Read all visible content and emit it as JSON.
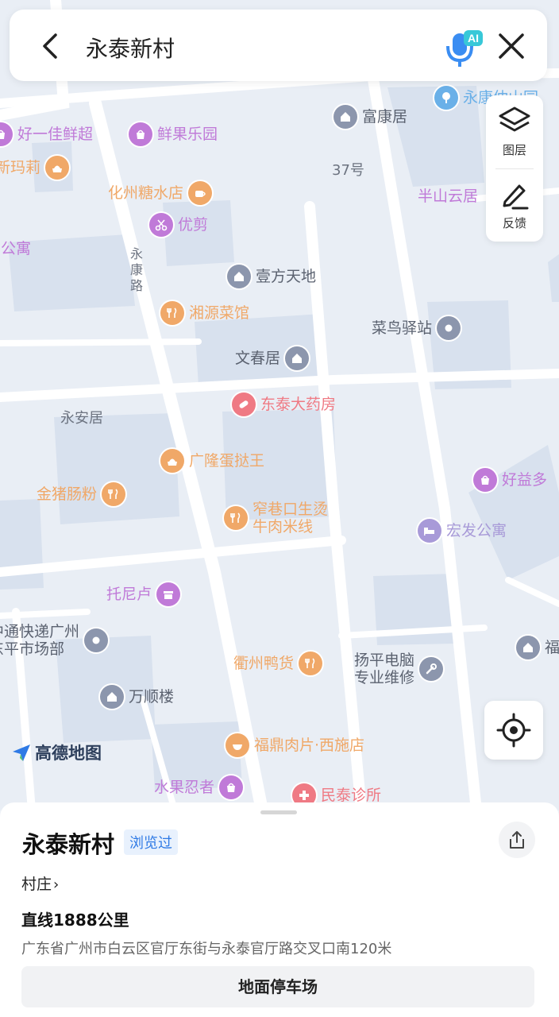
{
  "search": {
    "query": "永泰新村"
  },
  "side_controls": {
    "layers_label": "图层",
    "feedback_label": "反馈"
  },
  "map": {
    "logo_text": "高德地图",
    "pois": [
      {
        "id": "haoyijia",
        "name": "好一佳鲜超",
        "icon": "shopping-icon",
        "color": "#c07ad8"
      },
      {
        "id": "xianguo",
        "name": "鲜果乐园",
        "icon": "shopping-icon",
        "color": "#c07ad8"
      },
      {
        "id": "fukangju",
        "name": "富康居",
        "icon": "residence-icon",
        "color": "#8c96ad"
      },
      {
        "id": "yongtai_park",
        "name": "永康仲山园",
        "icon": "park-icon",
        "color": "#6ab0e8"
      },
      {
        "id": "xinmali",
        "name": "新玛莉",
        "icon": "cake-icon",
        "color": "#f0a868"
      },
      {
        "id": "huazhou",
        "name": "化州糖水店",
        "icon": "coffee-icon",
        "color": "#f0a868"
      },
      {
        "id": "banshan",
        "name": "半山云居",
        "icon": "residence-icon",
        "color": "#c07ad8"
      },
      {
        "id": "youjian",
        "name": "优剪",
        "icon": "scissors-icon",
        "color": "#c07ad8"
      },
      {
        "id": "gongyu_left",
        "name": "馆公寓",
        "icon": "residence-icon",
        "color": "#c07ad8"
      },
      {
        "id": "yifang",
        "name": "壹方天地",
        "icon": "residence-icon",
        "color": "#8c96ad"
      },
      {
        "id": "xiangyuan",
        "name": "湘源菜馆",
        "icon": "restaurant-icon",
        "color": "#f0a868"
      },
      {
        "id": "cainiao",
        "name": "菜鸟驿站",
        "icon": "dot-icon",
        "color": "#8c96ad"
      },
      {
        "id": "wenchun",
        "name": "文春居",
        "icon": "residence-icon",
        "color": "#8c96ad"
      },
      {
        "id": "dongtai",
        "name": "东泰大药房",
        "icon": "pill-icon",
        "color": "#ef7a84"
      },
      {
        "id": "guanglong",
        "name": "广隆蛋挞王",
        "icon": "cake-icon",
        "color": "#f0a868"
      },
      {
        "id": "haoyiduo",
        "name": "好益多",
        "icon": "shopping-icon",
        "color": "#c07ad8"
      },
      {
        "id": "jinzhu",
        "name": "金猪肠粉",
        "icon": "restaurant-icon",
        "color": "#f0a868"
      },
      {
        "id": "zhaixiang",
        "name": "窄巷口生烫\n牛肉米线",
        "icon": "restaurant-icon",
        "color": "#f0a868"
      },
      {
        "id": "hongfa",
        "name": "宏发公寓",
        "icon": "bed-icon",
        "color": "#a89ad8"
      },
      {
        "id": "tuonilu",
        "name": "托尼卢",
        "icon": "shop-icon",
        "color": "#c07ad8"
      },
      {
        "id": "zhongtong",
        "name": "中通快递广州\n东平市场部",
        "icon": "dot-icon",
        "color": "#8c96ad"
      },
      {
        "id": "quzhou",
        "name": "衢州鸭货",
        "icon": "restaurant-icon",
        "color": "#f0a868"
      },
      {
        "id": "yangping",
        "name": "扬平电脑\n专业维修",
        "icon": "wrench-icon",
        "color": "#8c96ad"
      },
      {
        "id": "fu_right",
        "name": "福",
        "icon": "residence-icon",
        "color": "#8c96ad"
      },
      {
        "id": "wanshun",
        "name": "万顺楼",
        "icon": "residence-icon",
        "color": "#8c96ad"
      },
      {
        "id": "fuding",
        "name": "福鼎肉片·西施店",
        "icon": "bowl-icon",
        "color": "#f0a868"
      },
      {
        "id": "shuiguo",
        "name": "水果忍者",
        "icon": "shopping-icon",
        "color": "#c07ad8"
      },
      {
        "id": "mintai",
        "name": "民泰诊所",
        "icon": "clinic-icon",
        "color": "#ef7a84"
      }
    ],
    "labels": {
      "house_37": "37号",
      "yongkang_road": "永康路",
      "yongan_ju": "永安居"
    }
  },
  "place": {
    "name": "永泰新村",
    "badge": "浏览过",
    "category": "村庄",
    "distance": "直线1888公里",
    "address": "广东省广州市白云区官厅东街与永泰官厅路交叉口南120米",
    "parking_button": "地面停车场"
  },
  "colors": {
    "accent": "#2f7ae5",
    "map_bg": "#e9eef5",
    "road": "#ffffff",
    "building": "#d9e2ee"
  }
}
